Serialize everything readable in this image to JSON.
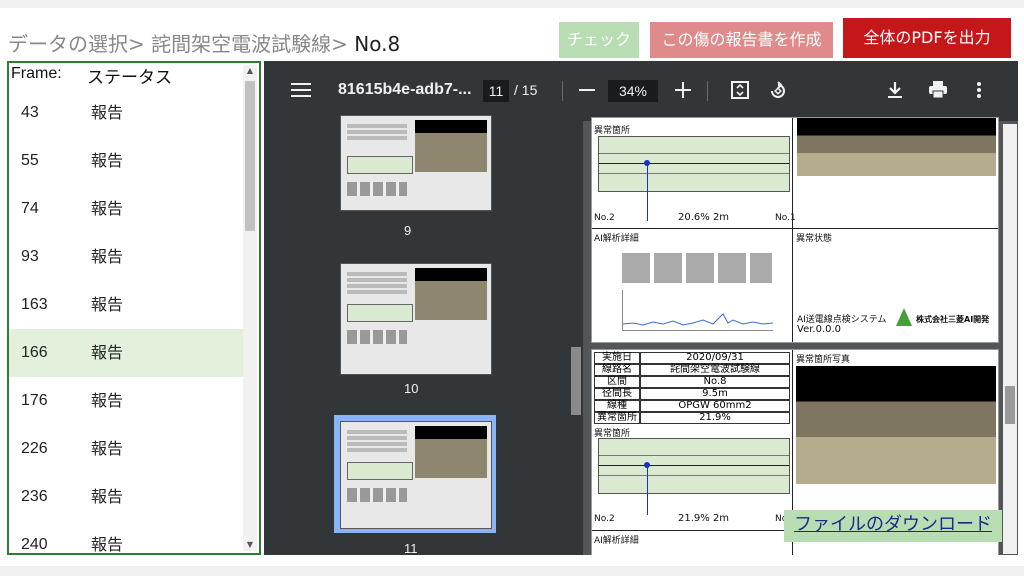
{
  "breadcrumb": {
    "part1": "データの選択",
    "sep1": "> ",
    "part2": "詫間架空電波試験線",
    "sep2": "> ",
    "current": "No.8"
  },
  "buttons": {
    "check": "チェック",
    "report": "この傷の報告書を作成",
    "pdf": "全体のPDFを出力"
  },
  "framelist": {
    "header_frame": "Frame:",
    "header_status": "ステータス",
    "rows": [
      {
        "frame": "43",
        "status": "報告"
      },
      {
        "frame": "55",
        "status": "報告"
      },
      {
        "frame": "74",
        "status": "報告"
      },
      {
        "frame": "93",
        "status": "報告"
      },
      {
        "frame": "163",
        "status": "報告"
      },
      {
        "frame": "166",
        "status": "報告",
        "selected": true
      },
      {
        "frame": "176",
        "status": "報告"
      },
      {
        "frame": "226",
        "status": "報告"
      },
      {
        "frame": "236",
        "status": "報告"
      },
      {
        "frame": "240",
        "status": "報告"
      }
    ]
  },
  "viewer": {
    "title": "81615b4e-adb7-...",
    "page": "11",
    "total": "/ 15",
    "zoom": "34%",
    "thumbs": [
      "9",
      "10",
      "11"
    ],
    "icons": [
      "menu-icon",
      "minus-icon",
      "plus-icon",
      "fit-page-icon",
      "rotate-icon",
      "download-icon",
      "print-icon",
      "more-icon"
    ]
  },
  "sheet1": {
    "anomaly_label": "異常箇所",
    "left": "No.2",
    "mid": "20.6% 2m",
    "right": "No.1",
    "ai_label": "AI解析詳細",
    "state_label": "異常状態",
    "system": "AI送電線点検システム",
    "version": "Ver.0.0.0",
    "company": "株式会社三菱AI開発"
  },
  "sheet2": {
    "rows": [
      {
        "k": "実施日",
        "v": "2020/09/31"
      },
      {
        "k": "線路名",
        "v": "詫間架空電波試験線"
      },
      {
        "k": "区間",
        "v": "No.8"
      },
      {
        "k": "径間長",
        "v": "9.5m"
      },
      {
        "k": "線種",
        "v": "OPGW 60mm2"
      },
      {
        "k": "異常箇所",
        "v": "21.9%"
      }
    ],
    "photo_label": "異常箇所写真",
    "anomaly_label": "異常箇所",
    "left": "No.2",
    "mid": "21.9% 2m",
    "right": "No.1",
    "ai_label": "AI解析詳細"
  },
  "download": "ファイルのダウンロード"
}
